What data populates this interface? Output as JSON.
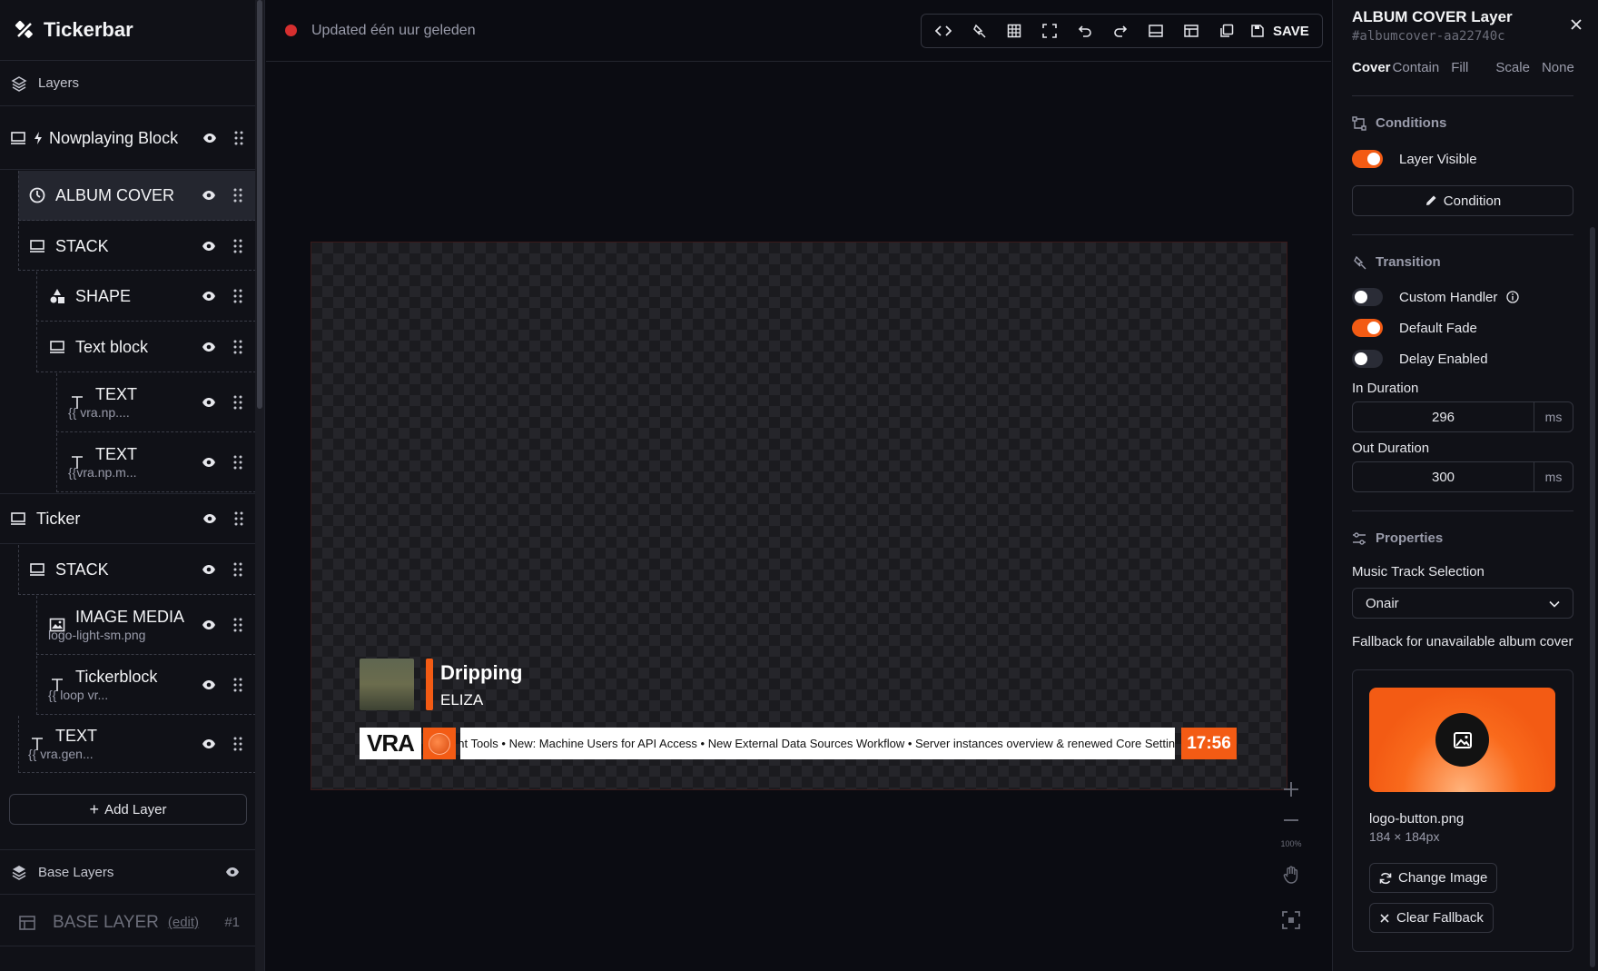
{
  "app": {
    "name": "Tickerbar"
  },
  "status": {
    "text": "Updated één uur geleden",
    "color": "#d62f2f"
  },
  "toolbar": {
    "save_label": "SAVE",
    "icons": [
      "code-icon",
      "magic-wand-icon",
      "grid-icon",
      "fullscreen-icon",
      "undo-icon",
      "redo-icon",
      "bottom-panel-icon",
      "layout-icon",
      "duplicate-icon"
    ]
  },
  "sidebar": {
    "layers_heading": "Layers",
    "groups": [
      {
        "title": "Nowplaying Block"
      },
      {
        "title": "ALBUM COVER"
      },
      {
        "title": "STACK"
      },
      {
        "title": "SHAPE"
      },
      {
        "title": "Text block"
      },
      {
        "title": "TEXT",
        "sub": "{{ vra.np...."
      },
      {
        "title": "TEXT",
        "sub": "{{vra.np.m..."
      },
      {
        "title": "Ticker"
      },
      {
        "title": "STACK"
      },
      {
        "title": "IMAGE MEDIA",
        "sub": "logo-light-sm.png"
      },
      {
        "title": "Tickerblock",
        "sub": "{{ loop vr..."
      },
      {
        "title": "TEXT",
        "sub": "{{ vra.gen..."
      }
    ],
    "add_layer_label": "Add Layer",
    "base_heading": "Base Layers",
    "base_layer": {
      "label": "BASE LAYER",
      "edit": "(edit)",
      "num": "#1"
    }
  },
  "canvas": {
    "nowplaying": {
      "title": "Dripping",
      "artist": "ELIZA"
    },
    "ticker": {
      "brand": "VRA",
      "text": "ent Tools  •  New: Machine Users for API Access  •  New External Data Sources Workflow  •  Server instances overview & renewed Core Settin",
      "time": "17:56"
    },
    "zoom_label": "100%",
    "accent": "#f35b14"
  },
  "panel": {
    "title": "ALBUM COVER Layer",
    "id": "#albumcover-aa22740c",
    "fit_tabs": [
      "Cover",
      "Contain",
      "Fill",
      "Scale",
      "None"
    ],
    "conditions": {
      "heading": "Conditions",
      "layer_visible": "Layer Visible",
      "layer_visible_on": true,
      "condition_btn": "Condition"
    },
    "transition": {
      "heading": "Transition",
      "custom_handler": "Custom Handler",
      "custom_handler_on": false,
      "default_fade": "Default Fade",
      "default_fade_on": true,
      "delay_enabled": "Delay Enabled",
      "delay_enabled_on": false,
      "in_label": "In Duration",
      "in_value": "296",
      "out_label": "Out Duration",
      "out_value": "300",
      "unit": "ms"
    },
    "properties": {
      "heading": "Properties",
      "music_label": "Music Track Selection",
      "music_value": "Onair",
      "fallback_label": "Fallback for unavailable album cover",
      "file_name": "logo-button.png",
      "file_dims": "184 × 184px",
      "change_btn": "Change Image",
      "clear_btn": "Clear Fallback"
    }
  }
}
